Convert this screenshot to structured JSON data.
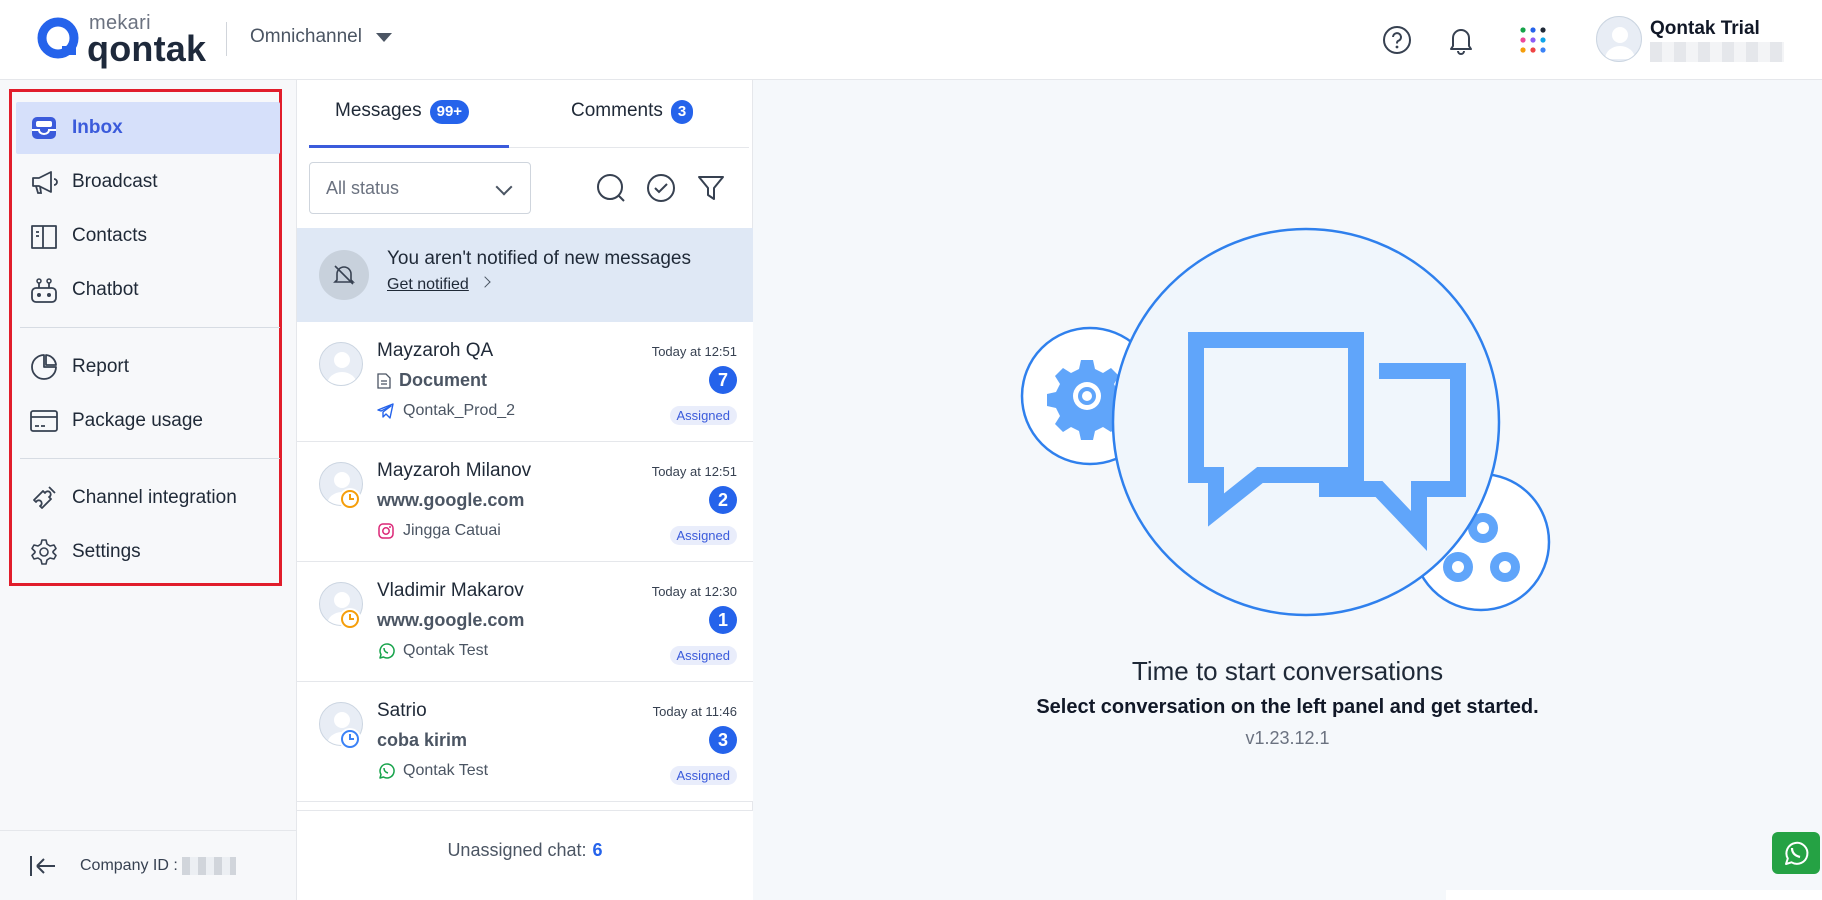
{
  "header": {
    "brand_top": "mekari",
    "brand_main": "qontak",
    "product": "Omnichannel",
    "user_name": "Qontak Trial"
  },
  "sidebar": {
    "items": [
      {
        "label": "Inbox",
        "icon": "inbox-icon",
        "active": true
      },
      {
        "label": "Broadcast",
        "icon": "megaphone-icon"
      },
      {
        "label": "Contacts",
        "icon": "contacts-book-icon"
      },
      {
        "label": "Chatbot",
        "icon": "robot-icon"
      },
      {
        "label": "Report",
        "icon": "pie-chart-icon"
      },
      {
        "label": "Package usage",
        "icon": "card-icon"
      },
      {
        "label": "Channel integration",
        "icon": "puzzle-icon"
      },
      {
        "label": "Settings",
        "icon": "gear-icon"
      }
    ],
    "company_id_label": "Company ID :"
  },
  "list": {
    "tabs": [
      {
        "label": "Messages",
        "badge": "99+",
        "active": true
      },
      {
        "label": "Comments",
        "badge": "3"
      }
    ],
    "status_filter": "All status",
    "notice": {
      "text": "You aren't notified of new messages",
      "link": "Get notified"
    },
    "conversations": [
      {
        "name": "Mayzaroh QA",
        "message": "Document",
        "channel": "Qontak_Prod_2",
        "channel_icon": "telegram-icon",
        "time": "Today at 12:51",
        "count": "7",
        "status": "Assigned",
        "has_doc_icon": true
      },
      {
        "name": "Mayzaroh Milanov",
        "message": "www.google.com",
        "channel": "Jingga Catuai",
        "channel_icon": "instagram-icon",
        "time": "Today at 12:51",
        "count": "2",
        "status": "Assigned",
        "clock_color": "#f59e0b"
      },
      {
        "name": "Vladimir Makarov",
        "message": "www.google.com",
        "channel": "Qontak Test",
        "channel_icon": "whatsapp-icon",
        "time": "Today at 12:30",
        "count": "1",
        "status": "Assigned",
        "clock_color": "#f59e0b"
      },
      {
        "name": "Satrio",
        "message": "coba kirim",
        "channel": "Qontak Test",
        "channel_icon": "whatsapp-icon",
        "time": "Today at 11:46",
        "count": "3",
        "status": "Assigned",
        "clock_color": "#3b82f6"
      }
    ],
    "unassigned_label": "Unassigned chat:",
    "unassigned_count": "6"
  },
  "main": {
    "title": "Time to start conversations",
    "subtitle": "Select conversation on the left panel and get started.",
    "version": "v1.23.12.1"
  },
  "colors": {
    "accent": "#3b5bdb",
    "badge": "#2563eb",
    "highlight_frame": "#e11d2b",
    "whatsapp": "#25a244"
  }
}
